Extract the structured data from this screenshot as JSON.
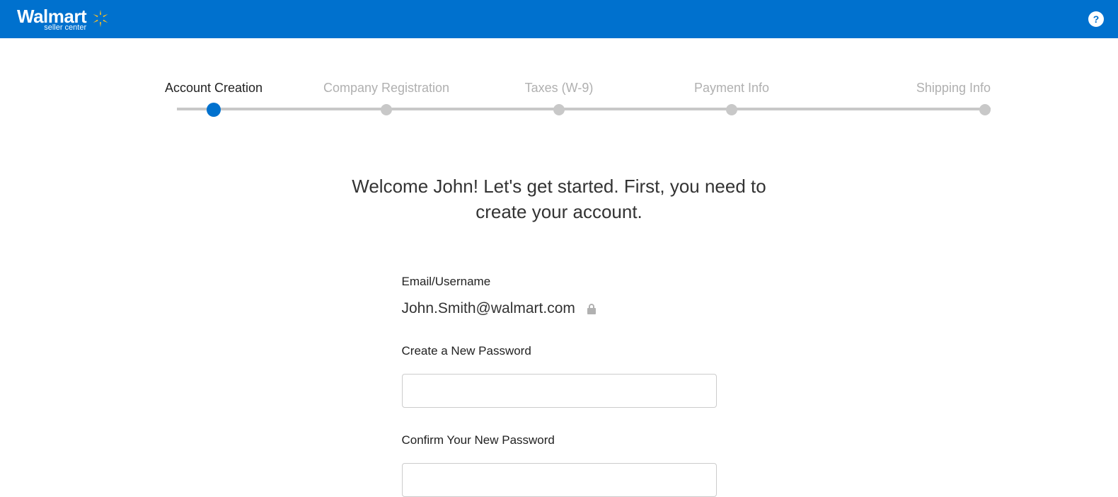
{
  "header": {
    "brand_main": "Walmart",
    "brand_sub": "seller center",
    "help_symbol": "?"
  },
  "stepper": {
    "steps": [
      {
        "label": "Account Creation",
        "active": true
      },
      {
        "label": "Company Registration",
        "active": false
      },
      {
        "label": "Taxes (W-9)",
        "active": false
      },
      {
        "label": "Payment Info",
        "active": false
      },
      {
        "label": "Shipping Info",
        "active": false
      }
    ]
  },
  "welcome_text": "Welcome John! Let's get started. First, you need to create your account.",
  "form": {
    "email_label": "Email/Username",
    "email_value": "John.Smith@walmart.com",
    "password_label": "Create a New Password",
    "confirm_password_label": "Confirm Your New Password"
  }
}
